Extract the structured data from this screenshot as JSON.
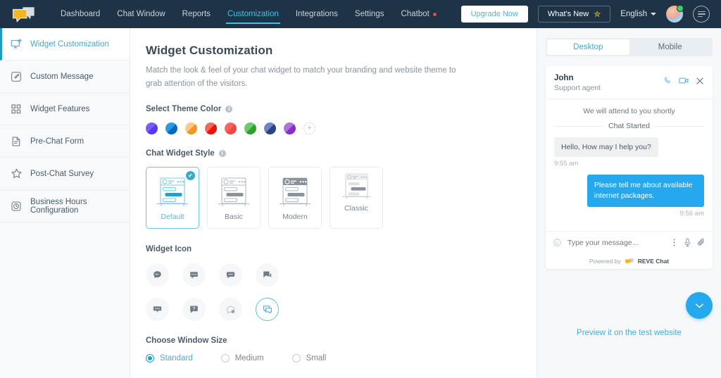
{
  "topnav": {
    "logo_name": "reve-chat-logo",
    "links": [
      {
        "label": "Dashboard",
        "active": false,
        "dot": false
      },
      {
        "label": "Chat Window",
        "active": false,
        "dot": false
      },
      {
        "label": "Reports",
        "active": false,
        "dot": false
      },
      {
        "label": "Customization",
        "active": true,
        "dot": false
      },
      {
        "label": "Integrations",
        "active": false,
        "dot": false
      },
      {
        "label": "Settings",
        "active": false,
        "dot": false
      },
      {
        "label": "Chatbot",
        "active": false,
        "dot": true
      }
    ],
    "upgrade_label": "Upgrade Now",
    "whats_new_label": "What's New",
    "language_label": "English",
    "accent": "#3fc3e0",
    "bg": "#1f3347"
  },
  "sidebar": {
    "items": [
      {
        "label": "Widget Customization",
        "icon": "widget-customization-icon",
        "active": true
      },
      {
        "label": "Custom Message",
        "icon": "custom-message-icon",
        "active": false
      },
      {
        "label": "Widget Features",
        "icon": "widget-features-icon",
        "active": false
      },
      {
        "label": "Pre-Chat Form",
        "icon": "pre-chat-form-icon",
        "active": false
      },
      {
        "label": "Post-Chat Survey",
        "icon": "post-chat-survey-icon",
        "active": false
      },
      {
        "label": "Business Hours Configuration",
        "icon": "business-hours-icon",
        "active": false
      }
    ]
  },
  "main": {
    "title": "Widget Customization",
    "description": "Match the look & feel of your chat widget to match your branding and website theme to grab attention of the visitors.",
    "theme_color": {
      "label": "Select Theme Color",
      "swatches": [
        {
          "name": "purple",
          "hex": "#6c4ff6"
        },
        {
          "name": "blue",
          "hex": "#0f82d8"
        },
        {
          "name": "orange",
          "hex": "#f2a03c"
        },
        {
          "name": "red",
          "hex": "#f02d20"
        },
        {
          "name": "coral",
          "hex": "#f6544f"
        },
        {
          "name": "green",
          "hex": "#45b846"
        },
        {
          "name": "navy",
          "hex": "#3a5a9c"
        },
        {
          "name": "violet",
          "hex": "#9b4fd0"
        }
      ],
      "add_label": "+"
    },
    "widget_style": {
      "label": "Chat Widget Style",
      "options": [
        {
          "label": "Default",
          "selected": true
        },
        {
          "label": "Basic",
          "selected": false
        },
        {
          "label": "Modern",
          "selected": false
        },
        {
          "label": "Classic",
          "selected": false
        }
      ],
      "check_glyph": "✔"
    },
    "widget_icon": {
      "label": "Widget Icon",
      "icons": [
        {
          "name": "chat-bubble-round-icon",
          "selected": false
        },
        {
          "name": "chat-bubble-square-icon",
          "selected": false
        },
        {
          "name": "chat-bubble-rounded-icon",
          "selected": false
        },
        {
          "name": "chat-bubble-corner-icon",
          "selected": false
        },
        {
          "name": "chat-bubble-tag-icon",
          "selected": false
        },
        {
          "name": "chat-bubble-question-icon",
          "selected": false
        },
        {
          "name": "chat-bubble-outline-icon",
          "selected": false
        },
        {
          "name": "chat-bubble-stacked-icon",
          "selected": true
        }
      ]
    },
    "window_size": {
      "label": "Choose Window Size",
      "options": [
        {
          "label": "Standard",
          "selected": true
        },
        {
          "label": "Medium",
          "selected": false
        },
        {
          "label": "Small",
          "selected": false
        }
      ]
    }
  },
  "preview": {
    "tabs": [
      {
        "label": "Desktop",
        "active": true
      },
      {
        "label": "Mobile",
        "active": false
      }
    ],
    "chat": {
      "agent_name": "John",
      "agent_role": "Support agent",
      "notice": "We will attend to you shortly",
      "divider_label": "Chat Started",
      "messages": [
        {
          "side": "in",
          "text": "Hello, How may I help you?",
          "time": "9:55 am"
        },
        {
          "side": "out",
          "text": "Please tell me about available internet packages.",
          "time": "9:56 am"
        }
      ],
      "input_placeholder": "Type your message...",
      "powered_by": "Powered by",
      "brand": "REVE Chat",
      "bubble_out_color": "#26a8ee"
    },
    "link_label": "Preview it on the test website"
  }
}
